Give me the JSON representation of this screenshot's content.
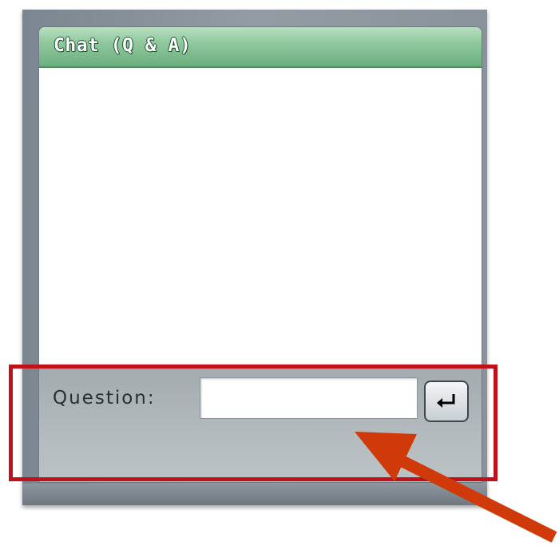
{
  "chat_panel": {
    "title": "Chat (Q & A)",
    "question_label": "Question:",
    "question_input": {
      "value": "",
      "placeholder": ""
    },
    "enter_button_icon": "enter-return-icon"
  },
  "annotation": {
    "highlight_color": "#c0101a",
    "arrow_color": "#d03a0a"
  },
  "colors": {
    "title_bar": "#8fc89d",
    "frame": "#8a939b"
  }
}
